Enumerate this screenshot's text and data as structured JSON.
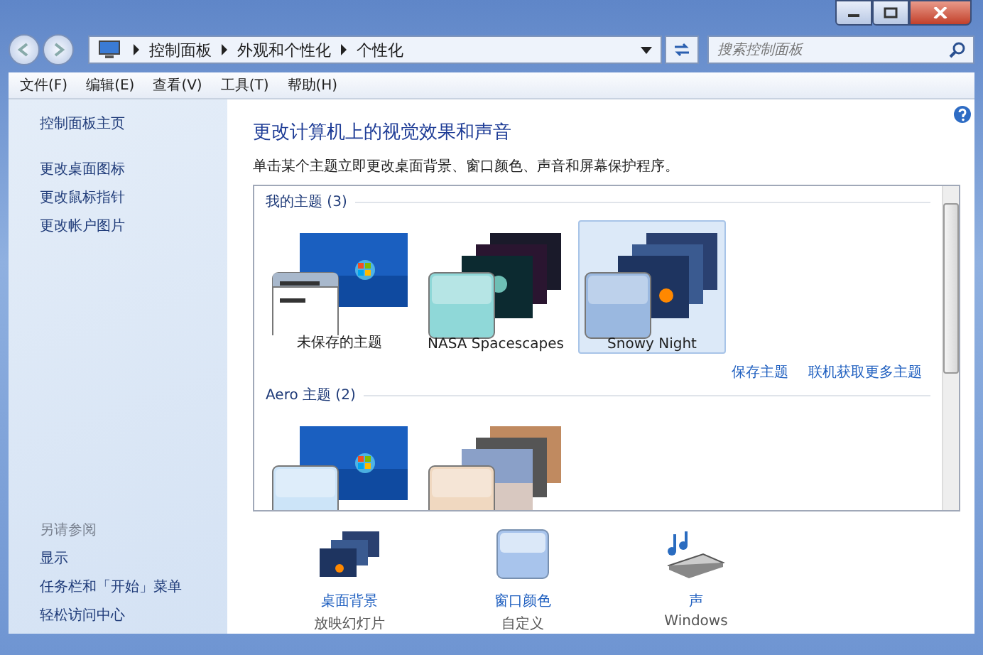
{
  "address_bar": {
    "breadcrumbs": [
      "控制面板",
      "外观和个性化",
      "个性化"
    ]
  },
  "search": {
    "placeholder": "搜索控制面板"
  },
  "menu": [
    "文件(F)",
    "编辑(E)",
    "查看(V)",
    "工具(T)",
    "帮助(H)"
  ],
  "sidebar": {
    "links": [
      {
        "label": "控制面板主页",
        "kind": "home"
      },
      {
        "label": "更改桌面图标",
        "kind": "task"
      },
      {
        "label": "更改鼠标指针",
        "kind": "task"
      },
      {
        "label": "更改帐户图片",
        "kind": "task"
      }
    ],
    "see_also_title": "另请参阅",
    "see_also": [
      "显示",
      "任务栏和「开始」菜单",
      "轻松访问中心"
    ]
  },
  "main": {
    "title": "更改计算机上的视觉效果和声音",
    "description": "单击某个主题立即更改桌面背景、窗口颜色、声音和屏幕保护程序。",
    "groups": [
      {
        "title": "我的主题 (3)",
        "themes": [
          {
            "name": "未保存的主题",
            "kind": "unsaved",
            "selected": false
          },
          {
            "name": "NASA Spacescapes",
            "kind": "space",
            "selected": false
          },
          {
            "name": "Snowy Night",
            "kind": "snow",
            "selected": true
          }
        ],
        "links": [
          "保存主题",
          "联机获取更多主题"
        ]
      },
      {
        "title": "Aero 主题 (2)",
        "themes": [
          {
            "kind": "windows7",
            "selected": false
          },
          {
            "kind": "landscape",
            "selected": false
          }
        ]
      }
    ]
  },
  "settings": [
    {
      "label": "桌面背景",
      "value": "放映幻灯片",
      "kind": "background"
    },
    {
      "label": "窗口颜色",
      "value": "自定义",
      "kind": "color"
    },
    {
      "label": "声",
      "value": "Windows",
      "kind": "sound"
    }
  ]
}
